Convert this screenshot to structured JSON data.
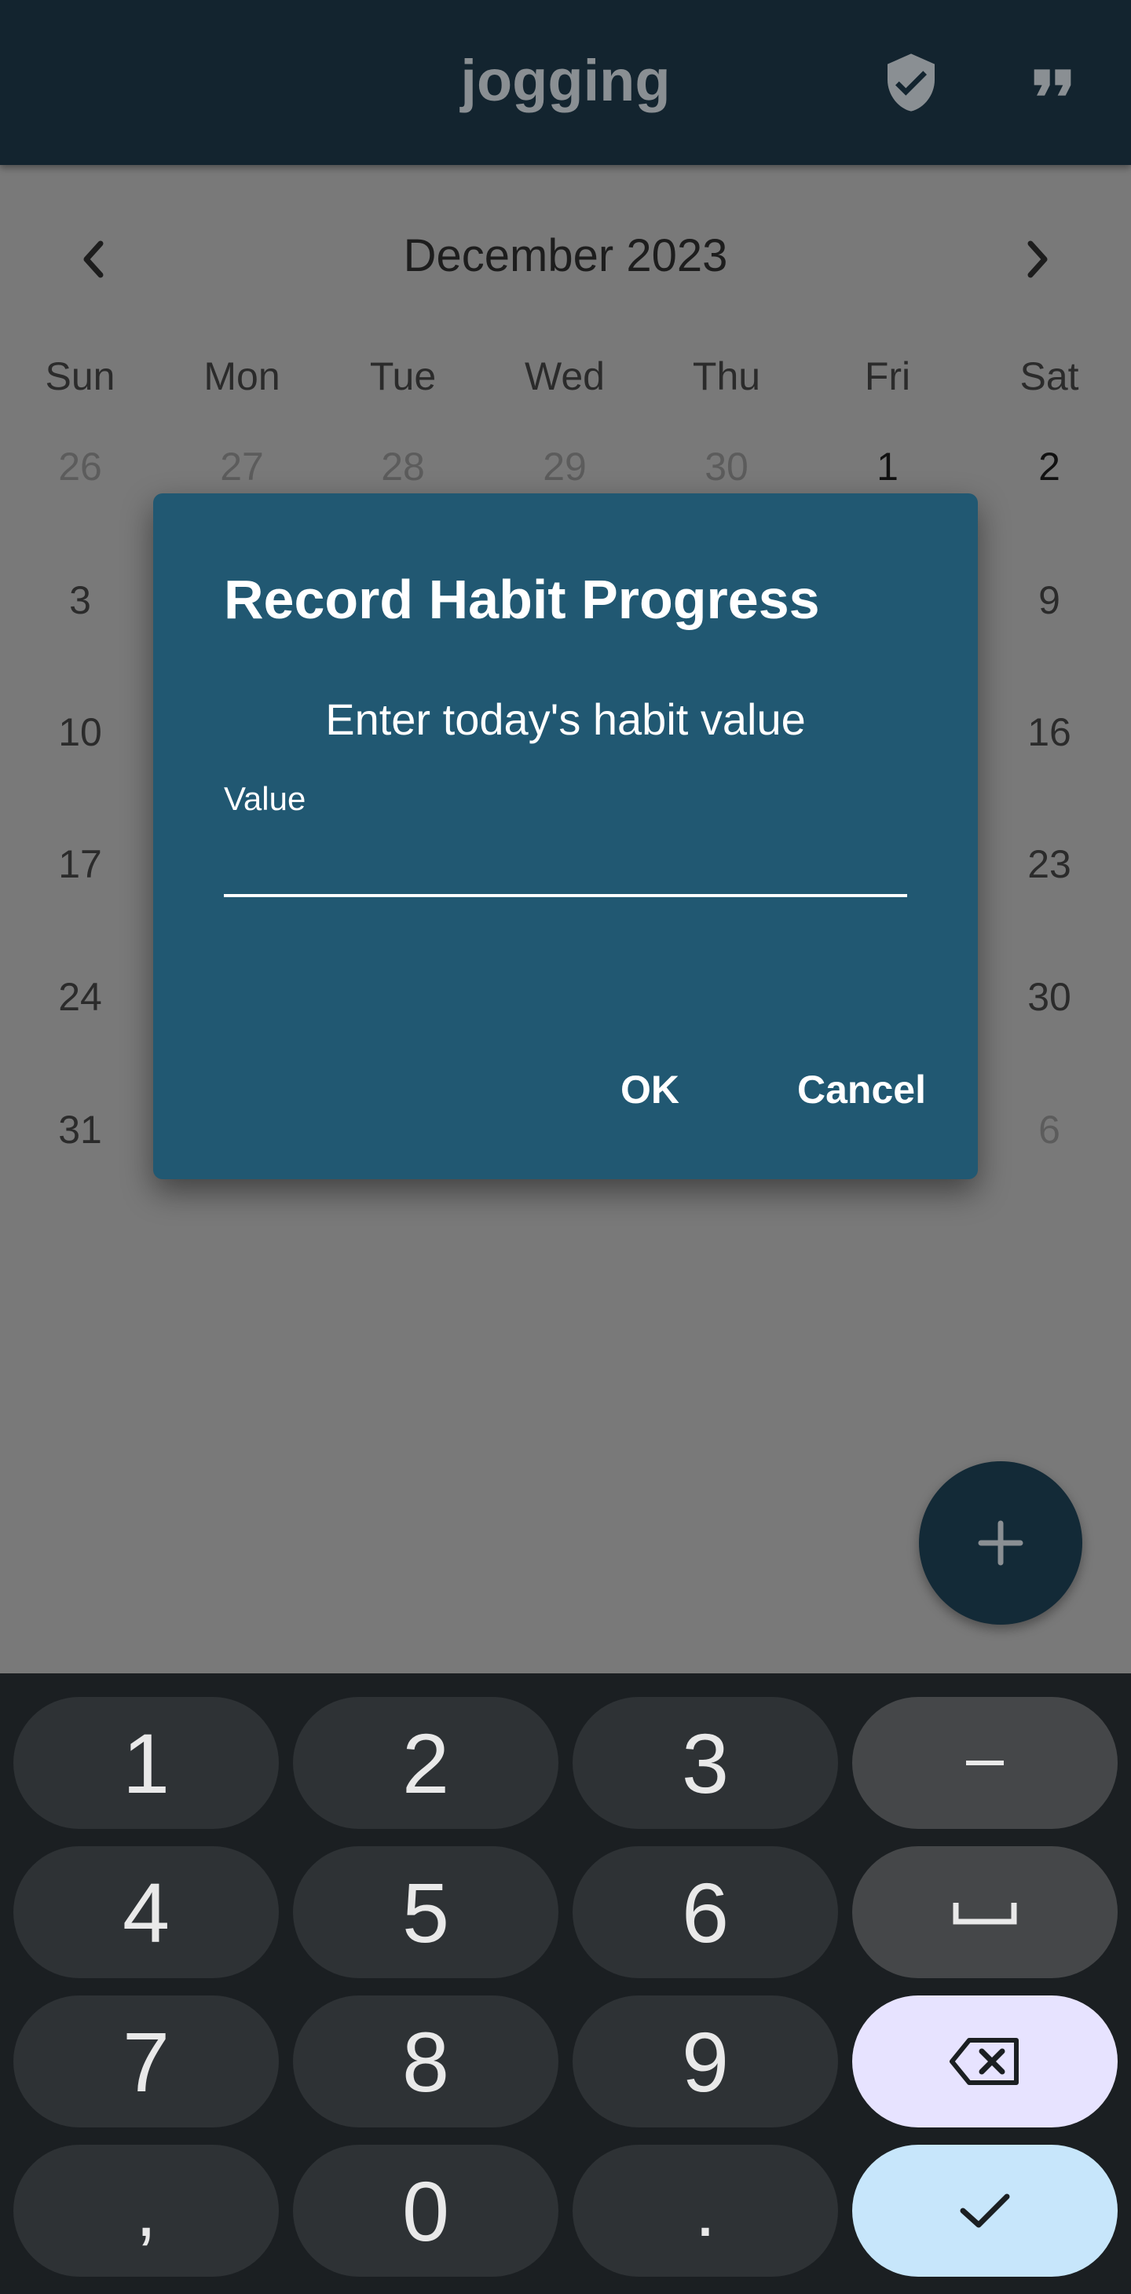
{
  "app_bar": {
    "title": "jogging",
    "icons": [
      "shield-check-icon",
      "format-quote-icon"
    ]
  },
  "calendar": {
    "month_label": "December 2023",
    "weekdays": [
      "Sun",
      "Mon",
      "Tue",
      "Wed",
      "Thu",
      "Fri",
      "Sat"
    ],
    "days": {
      "r0": [
        "26",
        "27",
        "28",
        "29",
        "30",
        "1",
        "2"
      ],
      "r1_sun": "3",
      "r1_sat": "9",
      "r2_sun": "10",
      "r2_sat": "16",
      "r3_sun": "17",
      "r3_sat": "23",
      "r4_sun": "24",
      "r4_sat": "30",
      "r5_sun": "31",
      "r5_sat": "6"
    }
  },
  "dialog": {
    "title": "Record Habit Progress",
    "message": "Enter today's habit value",
    "field_label": "Value",
    "field_value": "",
    "ok_label": "OK",
    "cancel_label": "Cancel"
  },
  "fab": {
    "icon": "plus-icon"
  },
  "keyboard": {
    "rows": [
      [
        "1",
        "2",
        "3",
        "−"
      ],
      [
        "4",
        "5",
        "6",
        "space"
      ],
      [
        "7",
        "8",
        "9",
        "backspace"
      ],
      [
        ",",
        "0",
        ".",
        "done"
      ]
    ]
  },
  "colors": {
    "app_bar": "#13242f",
    "dialog": "#215872",
    "scrim": "#7a7a7a",
    "keyboard": "#1b1f22",
    "key": "#2e3235",
    "key_function": "#454749",
    "key_backspace": "#e7e3ff",
    "key_done": "#c7e6fb"
  }
}
